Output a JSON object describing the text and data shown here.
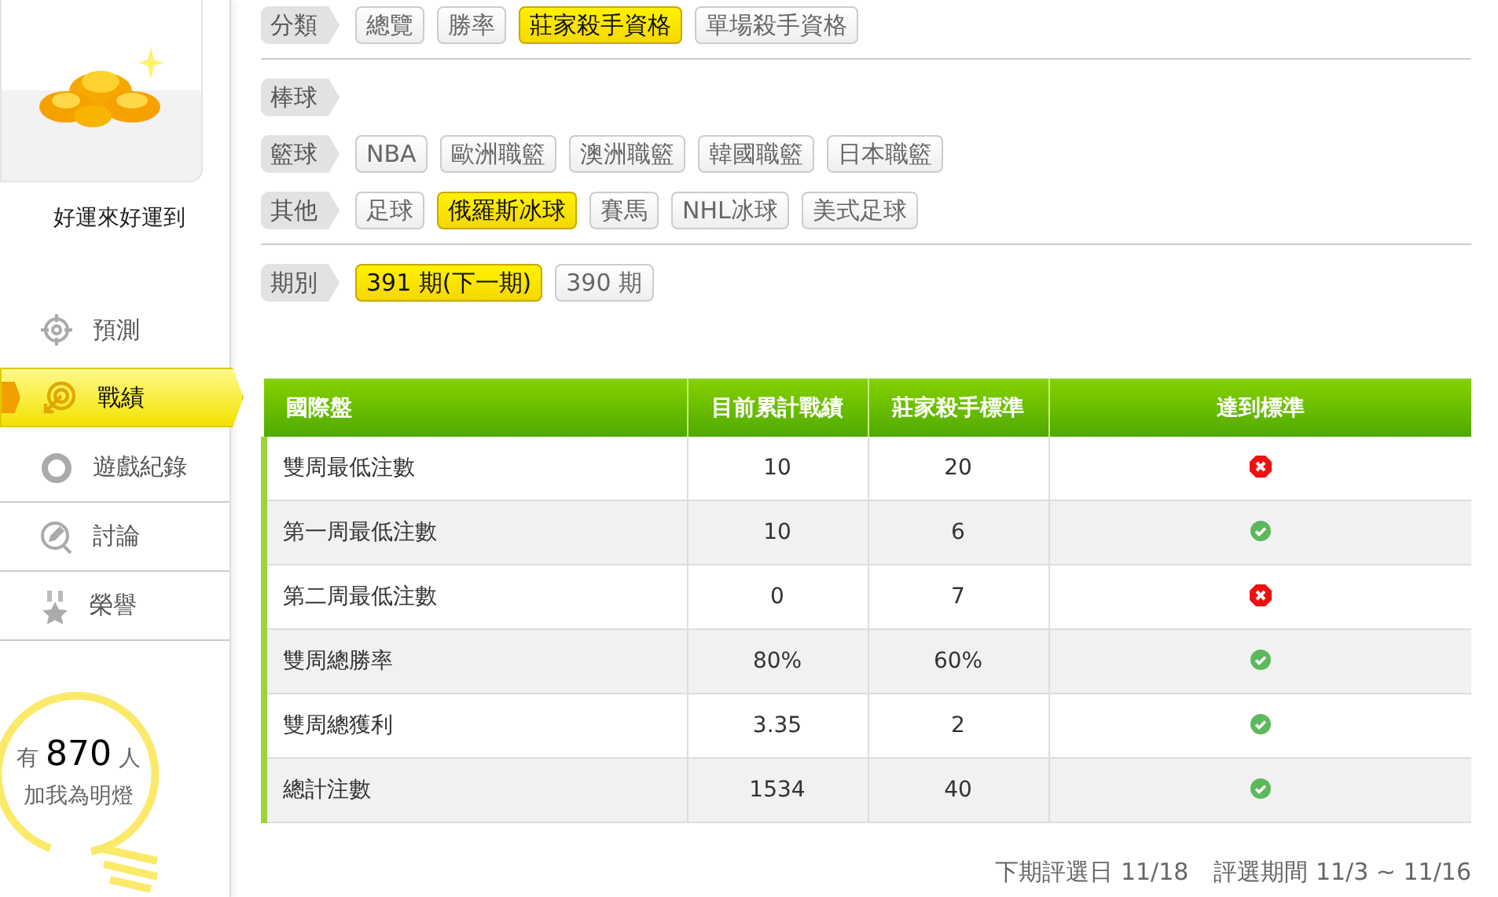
{
  "sidebar": {
    "user_name": "好運來好運到",
    "nav": [
      {
        "label": "預測",
        "kind": "crosshair",
        "selected": false
      },
      {
        "label": "戰績",
        "kind": "target",
        "selected": true
      },
      {
        "label": "遊戲紀錄",
        "kind": "ring",
        "selected": false
      },
      {
        "label": "討論",
        "kind": "chat",
        "selected": false
      },
      {
        "label": "榮譽",
        "kind": "medal",
        "selected": false
      }
    ],
    "fans": {
      "prefix": "有",
      "count": "870",
      "suffix": "人",
      "caption": "加我為明燈"
    }
  },
  "filter_sections": [
    {
      "groups": [
        {
          "label": "分類",
          "options": [
            {
              "text": "總覽",
              "selected": false
            },
            {
              "text": "勝率",
              "selected": false
            },
            {
              "text": "莊家殺手資格",
              "selected": true
            },
            {
              "text": "單場殺手資格",
              "selected": false
            }
          ]
        }
      ]
    },
    {
      "groups": [
        {
          "label": "棒球"
        },
        {
          "label": "籃球",
          "options": [
            {
              "text": "NBA",
              "selected": false
            },
            {
              "text": "歐洲職籃",
              "selected": false
            },
            {
              "text": "澳洲職籃",
              "selected": false
            },
            {
              "text": "韓國職籃",
              "selected": false
            },
            {
              "text": "日本職籃",
              "selected": false
            }
          ]
        },
        {
          "label": "其他",
          "options": [
            {
              "text": "足球",
              "selected": false
            },
            {
              "text": "俄羅斯冰球",
              "selected": true
            },
            {
              "text": "賽馬",
              "selected": false
            },
            {
              "text": "NHL冰球",
              "selected": false
            },
            {
              "text": "美式足球",
              "selected": false
            }
          ]
        }
      ]
    },
    {
      "groups": [
        {
          "label": "期別",
          "options": [
            {
              "text": "391 期(下一期)",
              "selected": true
            },
            {
              "text": "390 期",
              "selected": false
            }
          ]
        }
      ]
    }
  ],
  "table": {
    "columns": [
      "國際盤",
      "目前累計戰績",
      "莊家殺手標準",
      "達到標準"
    ],
    "rows": [
      {
        "item": "雙周最低注數",
        "current": "10",
        "standard": "20",
        "met": false
      },
      {
        "item": "第一周最低注數",
        "current": "10",
        "standard": "6",
        "met": true
      },
      {
        "item": "第二周最低注數",
        "current": "0",
        "standard": "7",
        "met": false
      },
      {
        "item": "雙周總勝率",
        "current": "80%",
        "standard": "60%",
        "met": true
      },
      {
        "item": "雙周總獲利",
        "current": "3.35",
        "standard": "2",
        "met": true
      },
      {
        "item": "總計注數",
        "current": "1534",
        "standard": "40",
        "met": true
      }
    ]
  },
  "footer": {
    "next_date": "下期評選日 11/18",
    "period": "評選期間 11/3 ~ 11/16"
  }
}
